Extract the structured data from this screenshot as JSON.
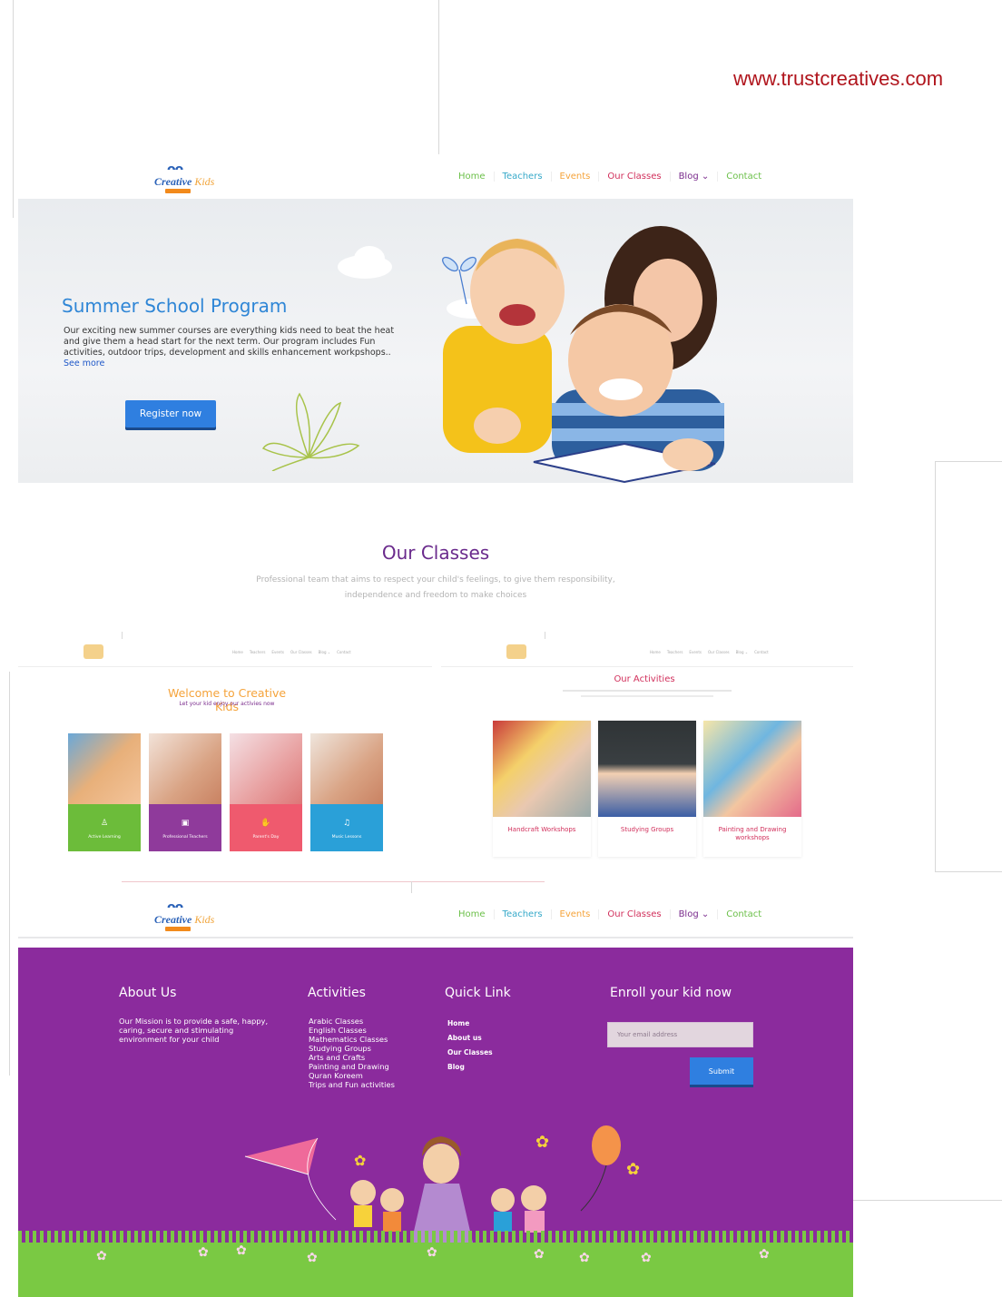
{
  "watermark": "www.trustcreatives.com",
  "nav": {
    "logo_top": "ᴖᴖ",
    "logo_word1": "Creative",
    "logo_word2": "Kids",
    "links": [
      "Home",
      "Teachers",
      "Events",
      "Our Classes",
      "Blog ⌄",
      "Contact"
    ],
    "link_colors": [
      "#6cc04a",
      "#36a9c9",
      "#f5a33a",
      "#d12f5b",
      "#7a2b8c",
      "#6cc04a"
    ]
  },
  "hero": {
    "title": "Summer School Program",
    "text": "Our exciting new summer courses are everything kids need to beat the heat and give them a head start for the next term. Our program includes Fun activities, outdoor trips, development and skills enhancement workpshops..",
    "see_more": "See more",
    "button": "Register now"
  },
  "classes": {
    "title": "Our Classes",
    "subtitle": "Professional team that aims to respect your child's feelings, to give them responsibility, independence and freedom to make choices"
  },
  "welcome": {
    "title": "Welcome to Creative Kids",
    "subtitle": "Let your kid enjoy our activies now",
    "cards": [
      {
        "label": "Active Learning",
        "color": "#6cbc3a",
        "icon": "blocks-icon"
      },
      {
        "label": "Professional Teachers",
        "color": "#8f3a9b",
        "icon": "teacher-icon"
      },
      {
        "label": "Parent's Day",
        "color": "#ef5a6e",
        "icon": "hand-icon"
      },
      {
        "label": "Music Lessons",
        "color": "#2aa0d8",
        "icon": "music-icon"
      }
    ]
  },
  "activities": {
    "title": "Our Activities",
    "cards": [
      {
        "label": "Handcraft Workshops"
      },
      {
        "label": "Studying Groups"
      },
      {
        "label": "Painting and Drawing workshops"
      }
    ]
  },
  "footer": {
    "about_title": "About Us",
    "about_text": "Our Mission is to provide a safe, happy, caring, secure and stimulating environment for your child",
    "activities_title": "Activities",
    "activities": [
      "Arabic Classes",
      "English Classes",
      "Mathematics Classes",
      "Studying Groups",
      "Arts and Crafts",
      "Painting and Drawing",
      "Quran Koreem",
      "Trips and Fun activities"
    ],
    "quick_title": "Quick Link",
    "quick_links": [
      "Home",
      "About us",
      "Our Classes",
      "Blog"
    ],
    "enroll_title": "Enroll your kid now",
    "email_placeholder": "Your email address",
    "submit": "Submit"
  }
}
